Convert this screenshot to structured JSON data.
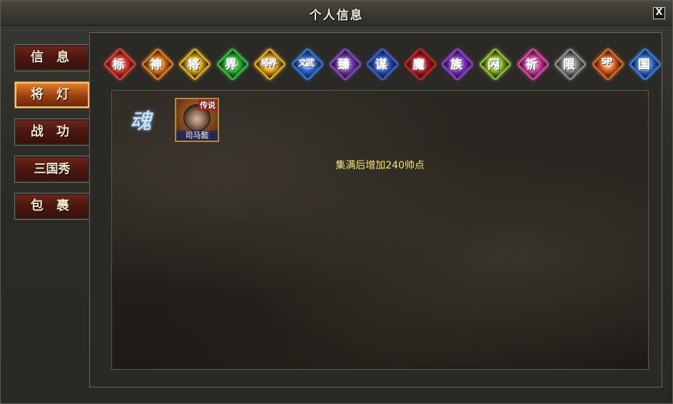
{
  "window": {
    "title": "个人信息",
    "close_label": "X"
  },
  "sidebar": {
    "items": [
      {
        "label": "信 息",
        "active": false
      },
      {
        "label": "将 灯",
        "active": true
      },
      {
        "label": "战 功",
        "active": false
      },
      {
        "label": "三国秀",
        "active": false
      },
      {
        "label": "包 裹",
        "active": false
      }
    ]
  },
  "badges": [
    {
      "glyph": "标",
      "color": "#e8362b"
    },
    {
      "glyph": "神",
      "color": "#ea7a1a"
    },
    {
      "glyph": "将",
      "color": "#e7b21c"
    },
    {
      "glyph": "界",
      "color": "#2fbf3a"
    },
    {
      "glyph": "将界",
      "color": "#f2b017"
    },
    {
      "glyph": "文武",
      "color": "#2e6ee0"
    },
    {
      "glyph": "臻",
      "color": "#7a3dbf"
    },
    {
      "glyph": "谋",
      "color": "#2f57d6"
    },
    {
      "glyph": "魔",
      "color": "#c2141f"
    },
    {
      "glyph": "族",
      "color": "#8a35d9"
    },
    {
      "glyph": "闪",
      "color": "#8fc42a"
    },
    {
      "glyph": "祈",
      "color": "#e23fa8"
    },
    {
      "glyph": "限",
      "color": "#8e8e8e"
    },
    {
      "glyph": "SP",
      "color": "#e8641e"
    },
    {
      "glyph": "国",
      "color": "#2d79e6"
    }
  ],
  "content": {
    "soul_glyph": "魂",
    "card": {
      "tag": "传说",
      "name": "司马懿"
    },
    "hint": "集满后增加240帅点"
  }
}
